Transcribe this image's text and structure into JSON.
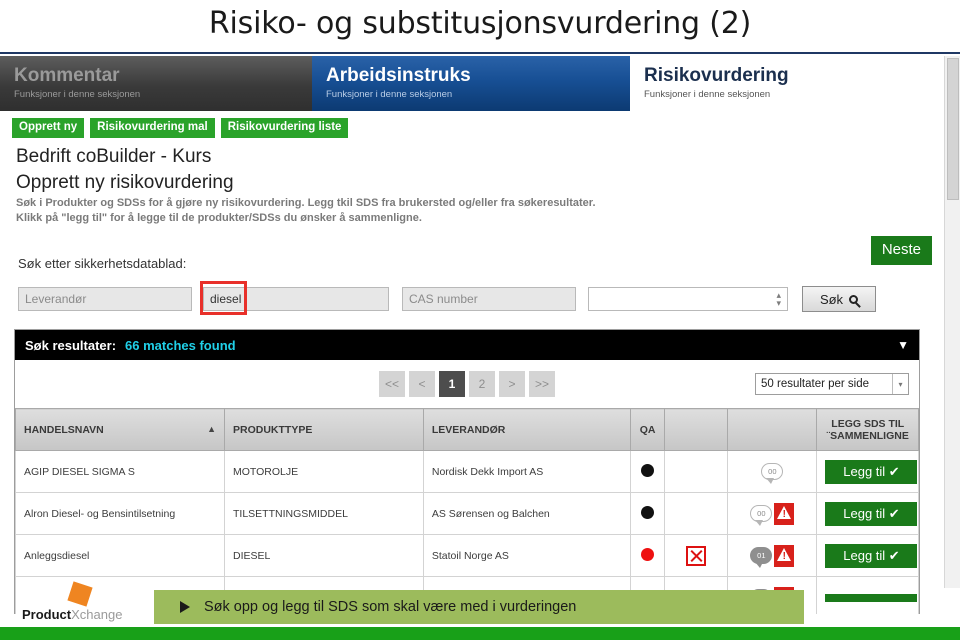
{
  "slide": {
    "title": "Risiko- og substitusjonsvurdering (2)"
  },
  "nav": {
    "tabs": [
      {
        "title": "Kommentar",
        "subtitle": "Funksjoner i denne seksjonen"
      },
      {
        "title": "Arbeidsinstruks",
        "subtitle": "Funksjoner i denne seksjonen"
      },
      {
        "title": "Risikovurdering",
        "subtitle": "Funksjoner i denne seksjonen"
      }
    ]
  },
  "actions": {
    "buttons": [
      "Opprett ny",
      "Risikovurdering mal",
      "Risikovurdering liste"
    ]
  },
  "page": {
    "company": "Bedrift coBuilder - Kurs",
    "heading": "Opprett ny risikovurdering",
    "intro_line1": "Søk i Produkter og SDSs for å gjøre ny risikovurdering. Legg tkil SDS fra brukersted og/eller fra søkeresultater.",
    "intro_line2": "Klikk på \"legg til\" for å legge til de produkter/SDSs du ønsker å sammenligne.",
    "next_button": "Neste"
  },
  "search": {
    "label": "Søk etter sikkerhetsdatablad:",
    "supplier_placeholder": "Leverandør",
    "supplier_value": "",
    "name_value": "diesel",
    "cas_placeholder": "CAS number",
    "cas_value": "",
    "select_value": "",
    "search_button": "Søk"
  },
  "results": {
    "bar_label": "Søk resultater:",
    "count_text": "66 matches found",
    "collapse_caret": "▼",
    "pager": {
      "first": "<<",
      "prev": "<",
      "pages": [
        "1",
        "2"
      ],
      "active_page": "1",
      "next": ">",
      "last": ">>"
    },
    "per_page": "50 resultater per side",
    "columns": [
      "HANDELSNAVN",
      "PRODUKTTYPE",
      "LEVERANDØR",
      "QA",
      "",
      "LEGG SDS TIL ¨SAMMENLIGNE"
    ],
    "sort_caret": "▲",
    "rows": [
      {
        "handelsnavn": "AGIP DIESEL SIGMA S",
        "produkttype": "MOTOROLJE",
        "leverandor": "Nordisk Dekk Import AS",
        "qa_color": "black",
        "has_xbox": false,
        "bubble_count": "00",
        "bubble_filled": false,
        "has_warning": false,
        "add_label": "Legg til ✔"
      },
      {
        "handelsnavn": "Alron Diesel- og Bensintilsetning",
        "produkttype": "TILSETTNINGSMIDDEL",
        "leverandor": "AS Sørensen og Balchen",
        "qa_color": "black",
        "has_xbox": false,
        "bubble_count": "00",
        "bubble_filled": false,
        "has_warning": true,
        "add_label": "Legg til ✔"
      },
      {
        "handelsnavn": "Anleggsdiesel",
        "produkttype": "DIESEL",
        "leverandor": "Statoil Norge AS",
        "qa_color": "red",
        "has_xbox": true,
        "bubble_count": "01",
        "bubble_filled": true,
        "has_warning": true,
        "add_label": "Legg til ✔"
      }
    ]
  },
  "banner": {
    "text": "Søk opp og legg til SDS som skal være med i vurderingen"
  },
  "logo": {
    "bold_part": "Product",
    "light_part": "Xchange"
  },
  "colors": {
    "accent_green": "#1a7a1a",
    "button_green": "#2aa32a",
    "tab_blue": "#174f94",
    "banner_green": "#9cbb5c",
    "footer_green": "#18a018",
    "highlight_red": "#e8302a",
    "count_cyan": "#20d0e8"
  }
}
